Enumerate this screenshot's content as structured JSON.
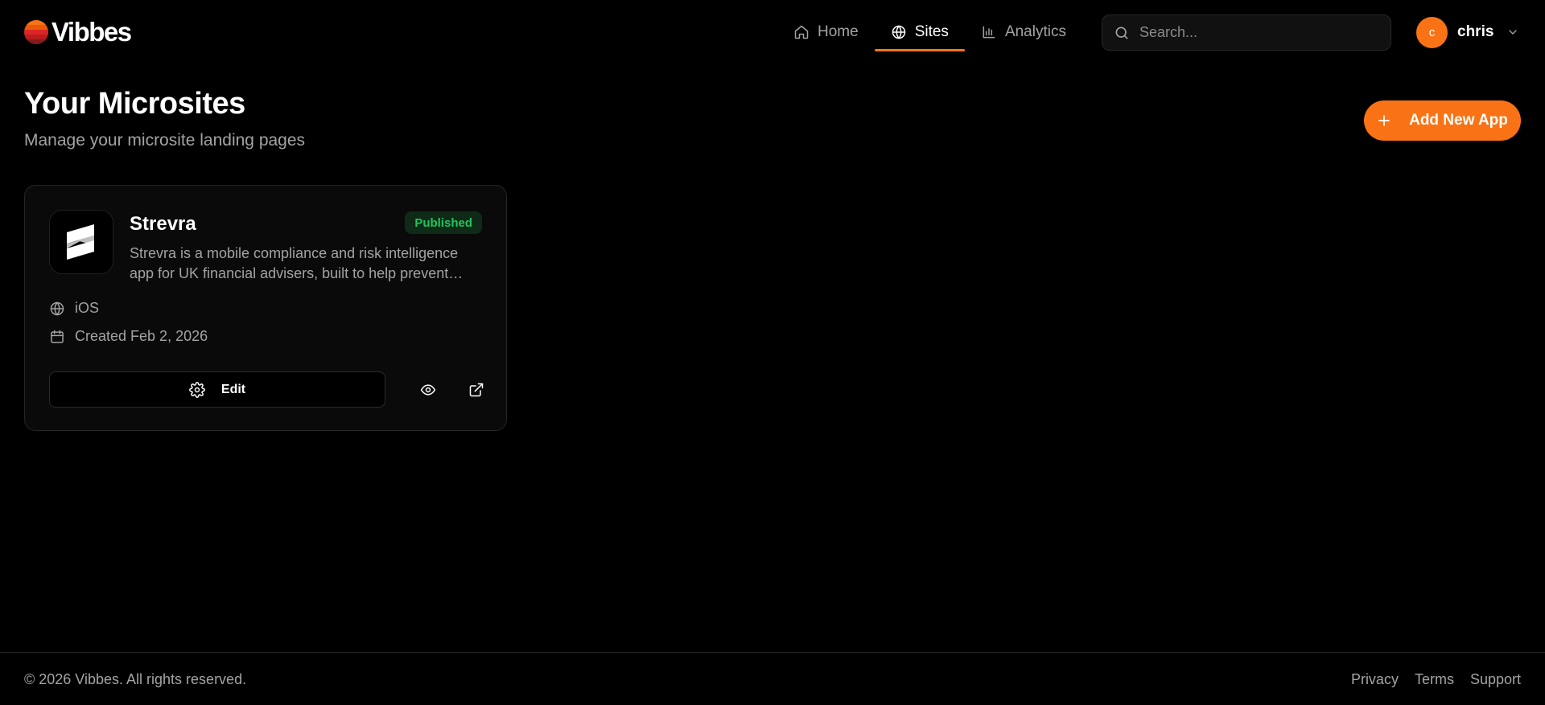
{
  "header": {
    "logo_text": "Vibbes",
    "logo_icon": "sunset-stripes-icon",
    "nav": [
      {
        "label": "Home",
        "icon": "home-icon",
        "active": false
      },
      {
        "label": "Sites",
        "icon": "globe-icon",
        "active": true
      },
      {
        "label": "Analytics",
        "icon": "bar-chart-icon",
        "active": false
      }
    ],
    "search_placeholder": "Search...",
    "user": {
      "initial": "c",
      "name": "chris"
    }
  },
  "page": {
    "title": "Your Microsites",
    "subtitle": "Manage your microsite landing pages",
    "add_button_label": "Add New App"
  },
  "sites": [
    {
      "name": "Strevra",
      "status": "Published",
      "description": "Strevra is a mobile compliance and risk intelligence app for UK financial advisers, built to help prevent financial crime and reduce compliance risk.",
      "platform": "iOS",
      "created": "Created Feb 2, 2026",
      "edit_label": "Edit"
    }
  ],
  "footer": {
    "copyright": "© 2026 Vibbes. All rights reserved.",
    "links": [
      "Privacy",
      "Terms",
      "Support"
    ]
  },
  "colors": {
    "background": "#000000",
    "accent": "#f97316",
    "published": "#22c55e",
    "muted_text": "#a3a3a3",
    "card": "#0a0a0a",
    "border": "#262626"
  }
}
